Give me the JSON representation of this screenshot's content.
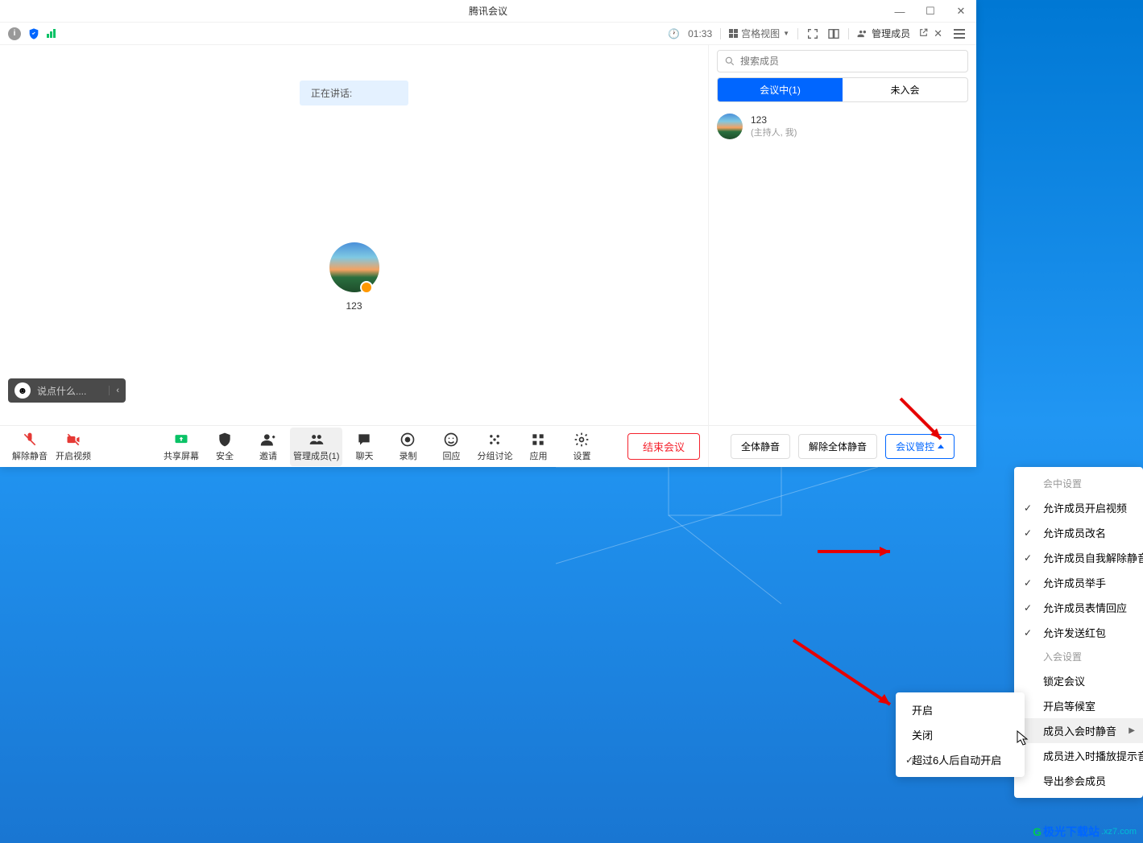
{
  "window": {
    "title": "腾讯会议"
  },
  "header": {
    "timer": "01:33",
    "view_label": "宫格视图",
    "members_panel_title": "管理成员"
  },
  "video": {
    "speaking_label": "正在讲话:",
    "participant_name": "123"
  },
  "chat": {
    "placeholder": "说点什么...."
  },
  "sidebar": {
    "search_placeholder": "搜索成员",
    "tabs": {
      "in_meeting": "会议中(1)",
      "not_joined": "未入会"
    },
    "member": {
      "name": "123",
      "role": "(主持人, 我)"
    },
    "footer": {
      "mute_all": "全体静音",
      "unmute_all": "解除全体静音",
      "control": "会议管控"
    }
  },
  "toolbar": {
    "unmute": "解除静音",
    "start_video": "开启视频",
    "share": "共享屏幕",
    "security": "安全",
    "invite": "邀请",
    "manage": "管理成员(1)",
    "chat": "聊天",
    "record": "录制",
    "react": "回应",
    "breakout": "分组讨论",
    "apps": "应用",
    "settings": "设置",
    "end": "结束会议"
  },
  "menu_control": {
    "section1": "会中设置",
    "allow_video": "允许成员开启视频",
    "allow_rename": "允许成员改名",
    "allow_unmute": "允许成员自我解除静音",
    "allow_raise": "允许成员举手",
    "allow_react": "允许成员表情回应",
    "allow_redpacket": "允许发送红包",
    "section2": "入会设置",
    "lock": "锁定会议",
    "waiting": "开启等候室",
    "mute_on_join": "成员入会时静音",
    "play_tone": "成员进入时播放提示音",
    "export": "导出参会成员"
  },
  "submenu": {
    "on": "开启",
    "off": "关闭",
    "auto6": "超过6人后自动开启"
  },
  "watermark": {
    "brand": "极光下载站",
    "site": ".xz7.com"
  }
}
